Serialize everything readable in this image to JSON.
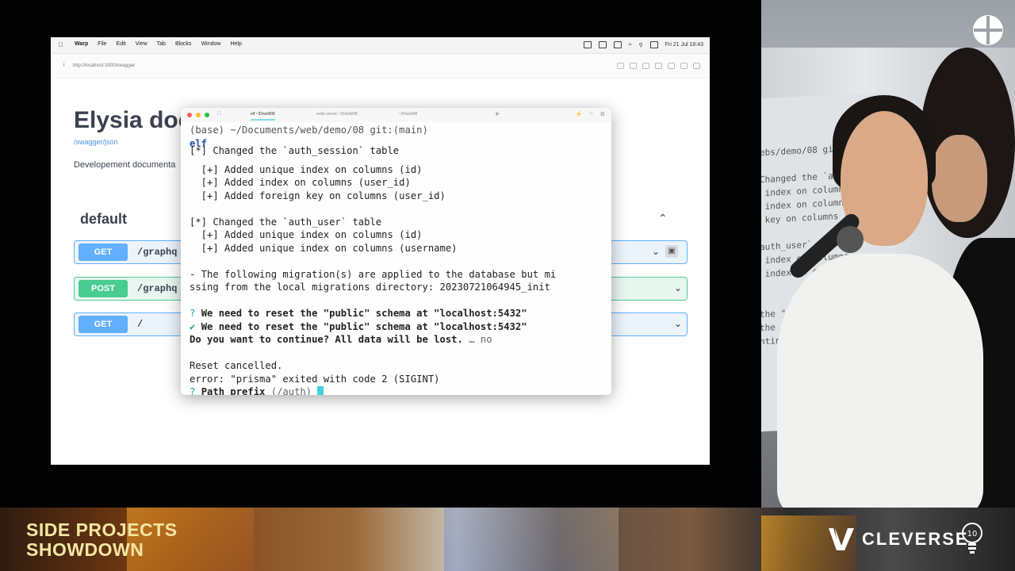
{
  "screen": {
    "menubar": {
      "app": "Warp",
      "menus": [
        "File",
        "Edit",
        "View",
        "Tab",
        "Blocks",
        "Window",
        "Help"
      ],
      "datetime": "Fri 21 Jul  18:43"
    },
    "address": {
      "url": "http://localhost:3000/swagger"
    },
    "swagger": {
      "title": "Elysia doc",
      "json_link": "/swagger/json",
      "description": "Developement documenta",
      "section": "default",
      "operations": [
        {
          "method": "GET",
          "path": "/graphq"
        },
        {
          "method": "POST",
          "path": "/graphq"
        },
        {
          "method": "GET",
          "path": "/"
        }
      ]
    }
  },
  "terminal": {
    "tabs": [
      "elf ~/D/w/d/08",
      "redis-server ~/D/w/d/08",
      "~/D/w/d/08"
    ],
    "prompt_path": "(base) ~/Documents/web/demo/08 git:(main)",
    "command": "elf",
    "lines": {
      "l01": "[*] Changed the `auth_session` table",
      "l02": "  [+] Added unique index on columns (id)",
      "l03": "  [+] Added index on columns (user_id)",
      "l04": "  [+] Added foreign key on columns (user_id)",
      "l05": "[*] Changed the `auth_user` table",
      "l06": "  [+] Added unique index on columns (id)",
      "l07": "  [+] Added unique index on columns (username)",
      "l08": "- The following migration(s) are applied to the database but mi",
      "l09": "ssing from the local migrations directory: 20230721064945_init",
      "q1_mark": "?",
      "q1_text": "We need to reset the \"public\" schema at \"localhost:5432\"",
      "q2_mark": "✔",
      "q2_text": "We need to reset the \"public\" schema at \"localhost:5432\"",
      "q3_text": "Do you want to continue? All data will be lost.",
      "q3_answer": "… no",
      "l10": "Reset cancelled.",
      "l11": "error: \"prisma\" exited with code 2 (SIGINT)",
      "q4_mark": "?",
      "q4_text": "Path prefix",
      "q4_default": "(/auth)"
    }
  },
  "camera": {
    "projected_text": "ebs/demo/08 git:(main)\n\nChanged the `auth_sessio\n index on columns\n index on columns (user_i\n key on columns (us\n\nauth_user` table\n index on columns\n index on columns (username)\n\n\nthe \"publi\nthe \"publ\nntinue? Al"
  },
  "banner": {
    "show_title": "SIDE PROJECTS\nSHOWDOWN",
    "brand": "CLEVERSE",
    "accent_color": "#f4e6a0"
  }
}
